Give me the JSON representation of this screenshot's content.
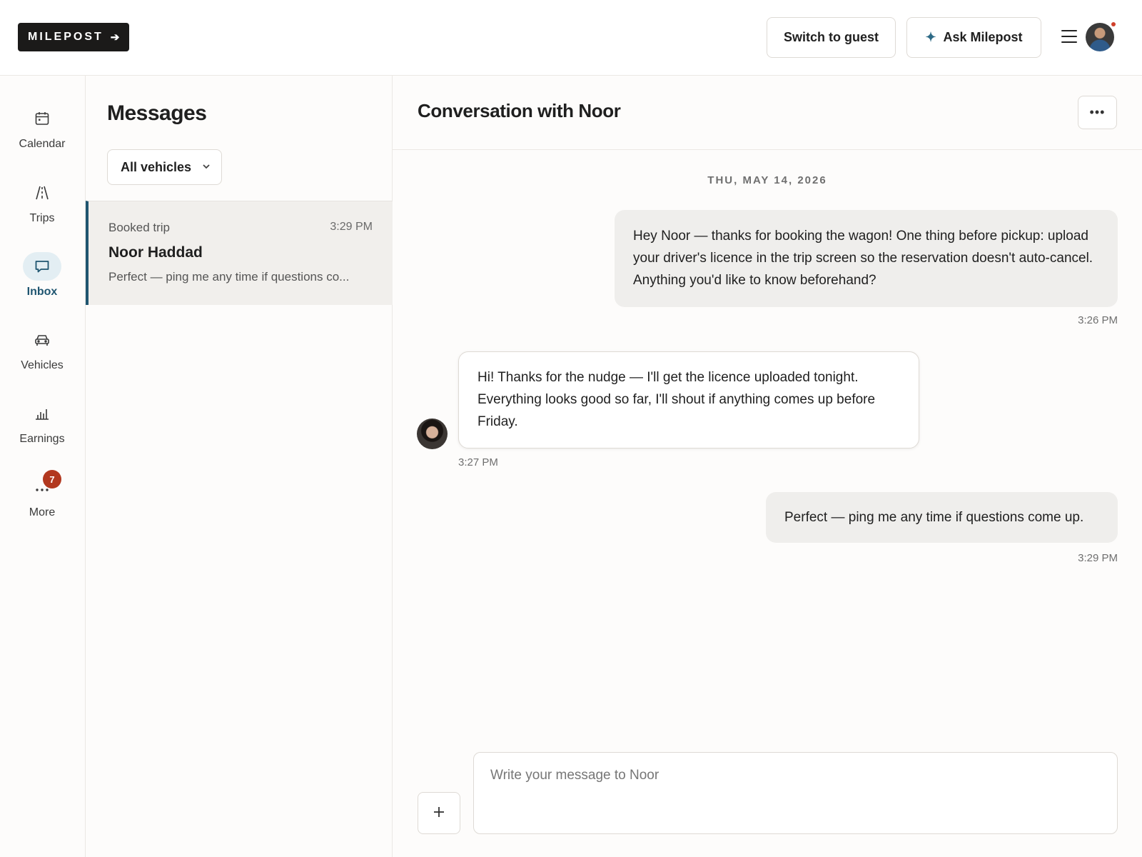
{
  "header": {
    "logo_text": "MILEPOST",
    "logo_arrow": "➔",
    "switch_label": "Switch to guest",
    "ask_label": "Ask Milepost",
    "ask_icon": "sparkle-icon",
    "menu_icon": "hamburger-icon"
  },
  "rail": {
    "items": [
      {
        "label": "Calendar",
        "icon": "calendar-icon"
      },
      {
        "label": "Trips",
        "icon": "road-icon"
      },
      {
        "label": "Inbox",
        "icon": "chat-icon",
        "active": true
      },
      {
        "label": "Vehicles",
        "icon": "car-icon"
      },
      {
        "label": "Earnings",
        "icon": "bar-chart-icon"
      },
      {
        "label": "More",
        "icon": "more-dots-icon",
        "badge": "7"
      }
    ]
  },
  "list": {
    "title": "Messages",
    "filter_label": "All vehicles",
    "threads": [
      {
        "kind": "Booked trip",
        "time": "3:29 PM",
        "name": "Noor Haddad",
        "preview": "Perfect — ping me any time if questions co..."
      }
    ]
  },
  "conversation": {
    "title": "Conversation with Noor",
    "date": "THU, MAY 14, 2026",
    "messages": [
      {
        "direction": "out",
        "text": "Hey Noor — thanks for booking the wagon! One thing before pickup: upload your driver's licence in the trip screen so the reservation doesn't auto-cancel. Anything you'd like to know beforehand?",
        "time": "3:26 PM"
      },
      {
        "direction": "in",
        "text": "Hi! Thanks for the nudge — I'll get the licence uploaded tonight. Everything looks good so far, I'll shout if anything comes up before Friday.",
        "time": "3:27 PM"
      },
      {
        "direction": "out",
        "text": "Perfect — ping me any time if questions come up.",
        "time": "3:29 PM"
      }
    ],
    "composer_placeholder": "Write your message to Noor",
    "composer_value": ""
  },
  "colors": {
    "accent": "#1f5570",
    "badge": "#b2381f",
    "logo_bg": "#1b1a19"
  }
}
